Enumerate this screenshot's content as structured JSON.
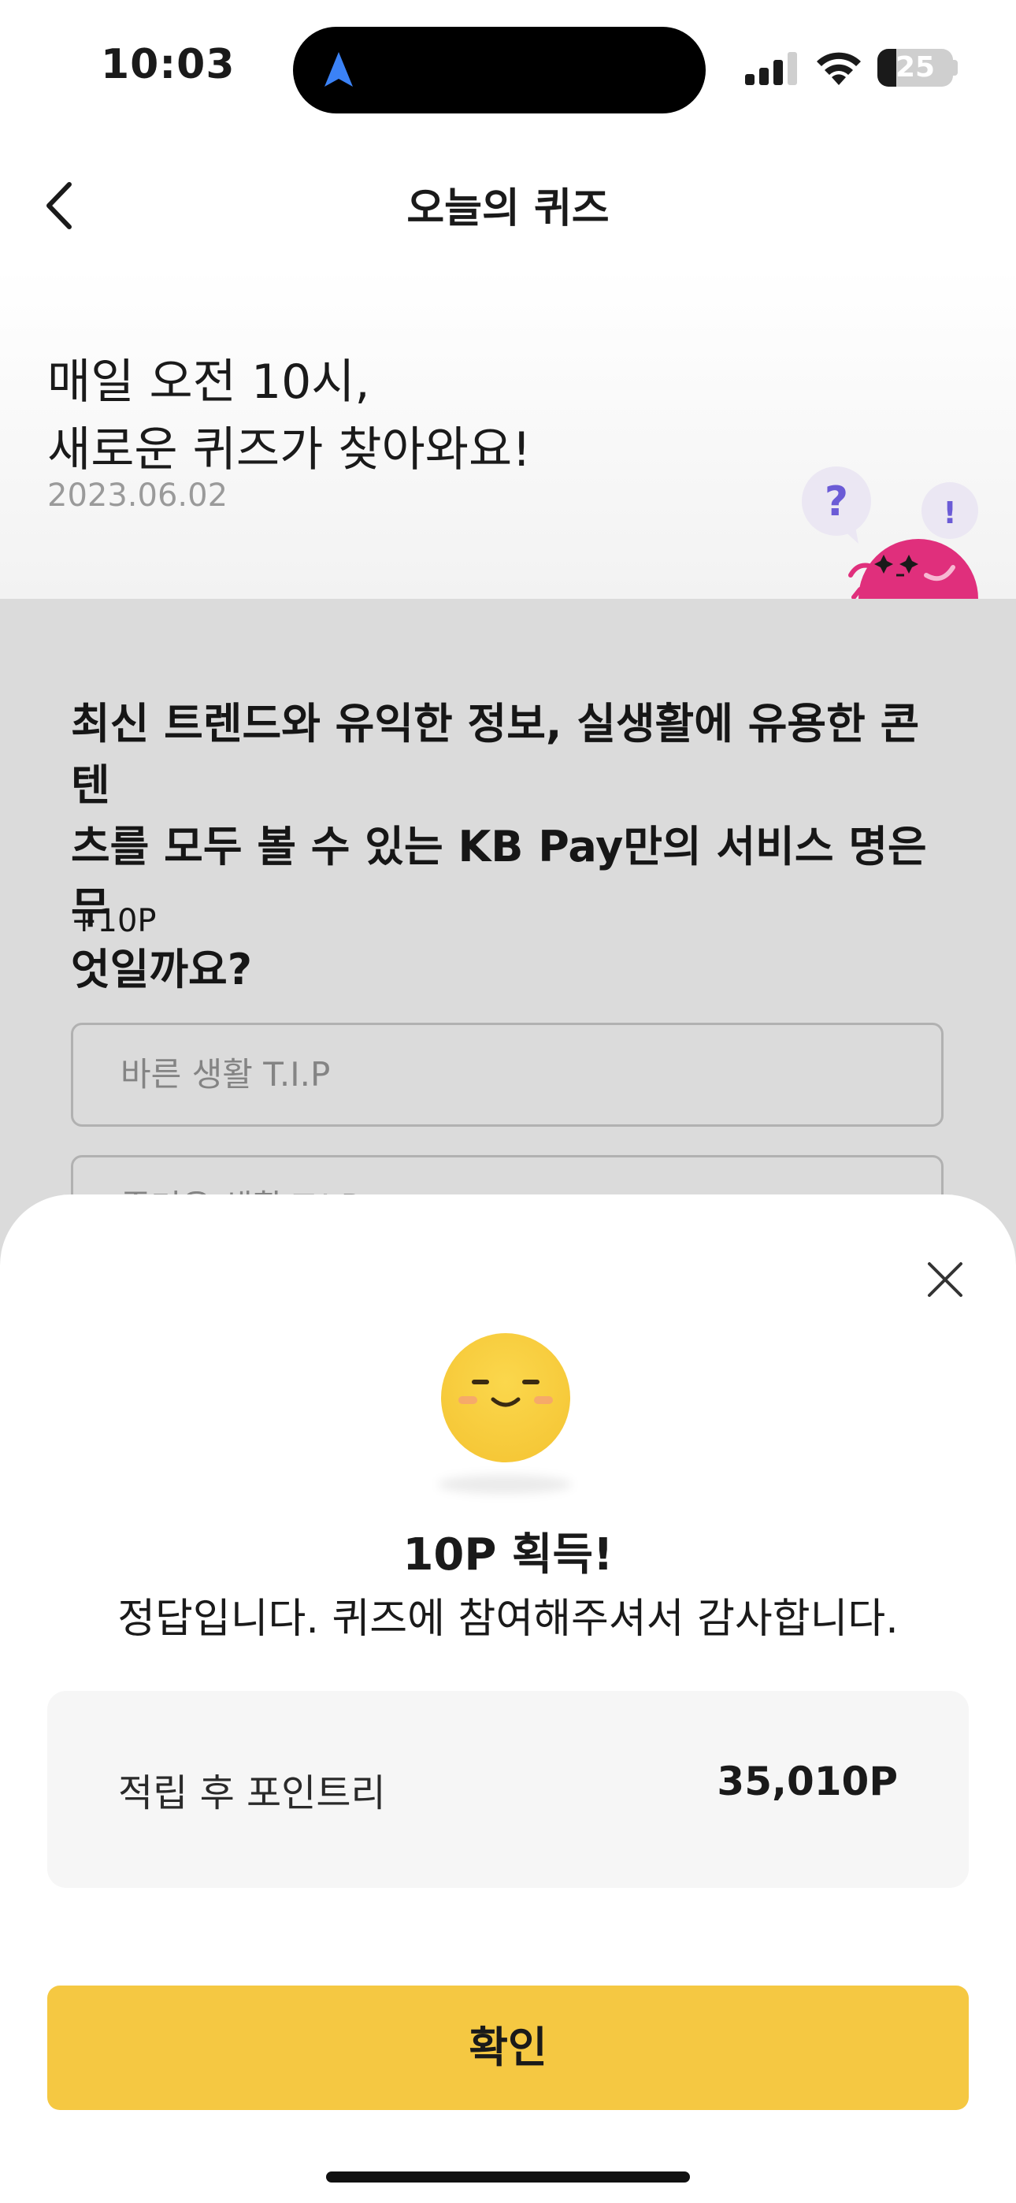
{
  "status_bar": {
    "time": "10:03",
    "battery": "25",
    "battery_level": 0.25
  },
  "header": {
    "title": "오늘의 퀴즈"
  },
  "hero": {
    "line1": "매일 오전 10시,",
    "line2": "새로운 퀴즈가 찾아와요!",
    "date": "2023.06.02",
    "bubble_question": "?",
    "bubble_exclaim": "!"
  },
  "quiz": {
    "question_lines": [
      "최신 트렌드와 유익한 정보, 실생활에 유용한 콘텐",
      "츠를 모두 볼 수 있는 KB Pay만의 서비스 명은 무",
      "엇일까요?"
    ],
    "points": "+10P",
    "options": [
      "바른 생활 T.I.P",
      "즐거운 생활 T.I.P"
    ]
  },
  "result": {
    "title": "10P 획득!",
    "message": "정답입니다. 퀴즈에 참여해주셔서 감사합니다.",
    "points_label": "적립 후 포인트리",
    "points_value": "35,010P",
    "confirm_label": "확인"
  },
  "colors": {
    "accent": "#f5c842",
    "mascot": "#e02f7c",
    "bubble_mark": "#6b5bd6"
  },
  "icons": [
    "back-chevron-icon",
    "close-icon",
    "navigation-arrow-icon",
    "signal-icon",
    "wifi-icon",
    "battery-icon"
  ]
}
